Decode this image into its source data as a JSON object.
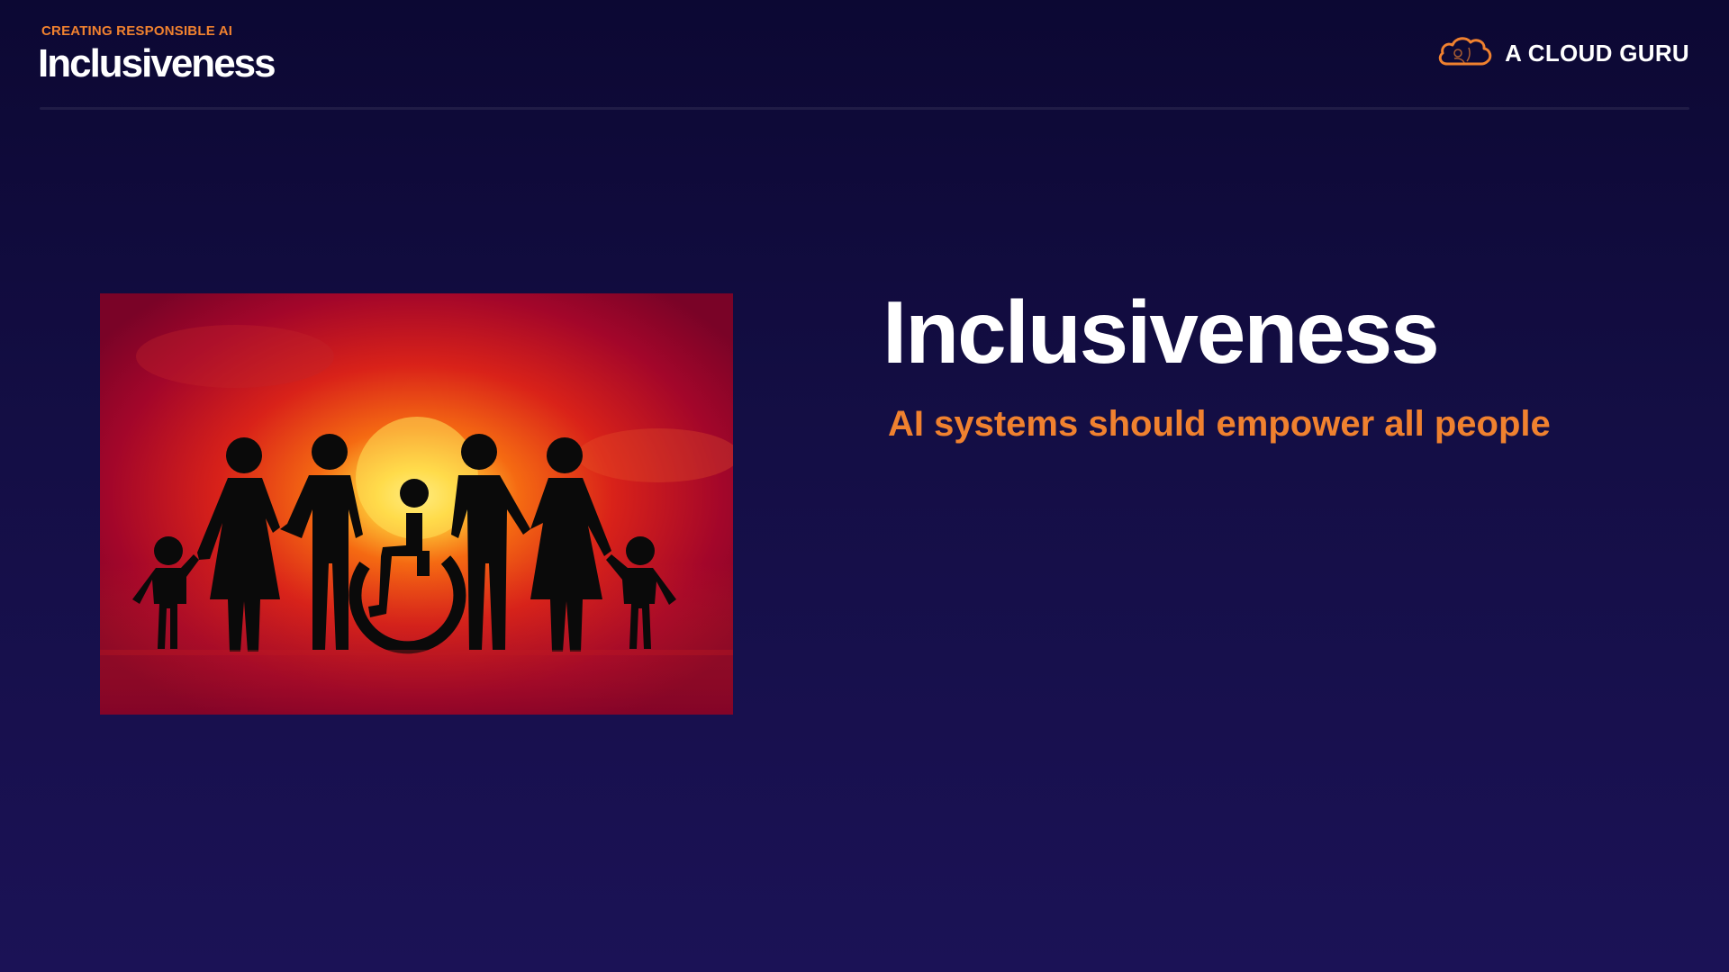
{
  "header": {
    "eyebrow": "CREATING RESPONSIBLE AI",
    "title": "Inclusiveness"
  },
  "logo": {
    "icon": "cloud-logo-icon",
    "text": "A CLOUD GURU"
  },
  "hero_image": {
    "description_icon": "family-silhouette-sunset-image"
  },
  "content": {
    "title": "Inclusiveness",
    "subtitle": "AI systems should empower all people"
  },
  "colors": {
    "accent": "#f0812f",
    "background": "#140e45",
    "text": "#ffffff"
  }
}
